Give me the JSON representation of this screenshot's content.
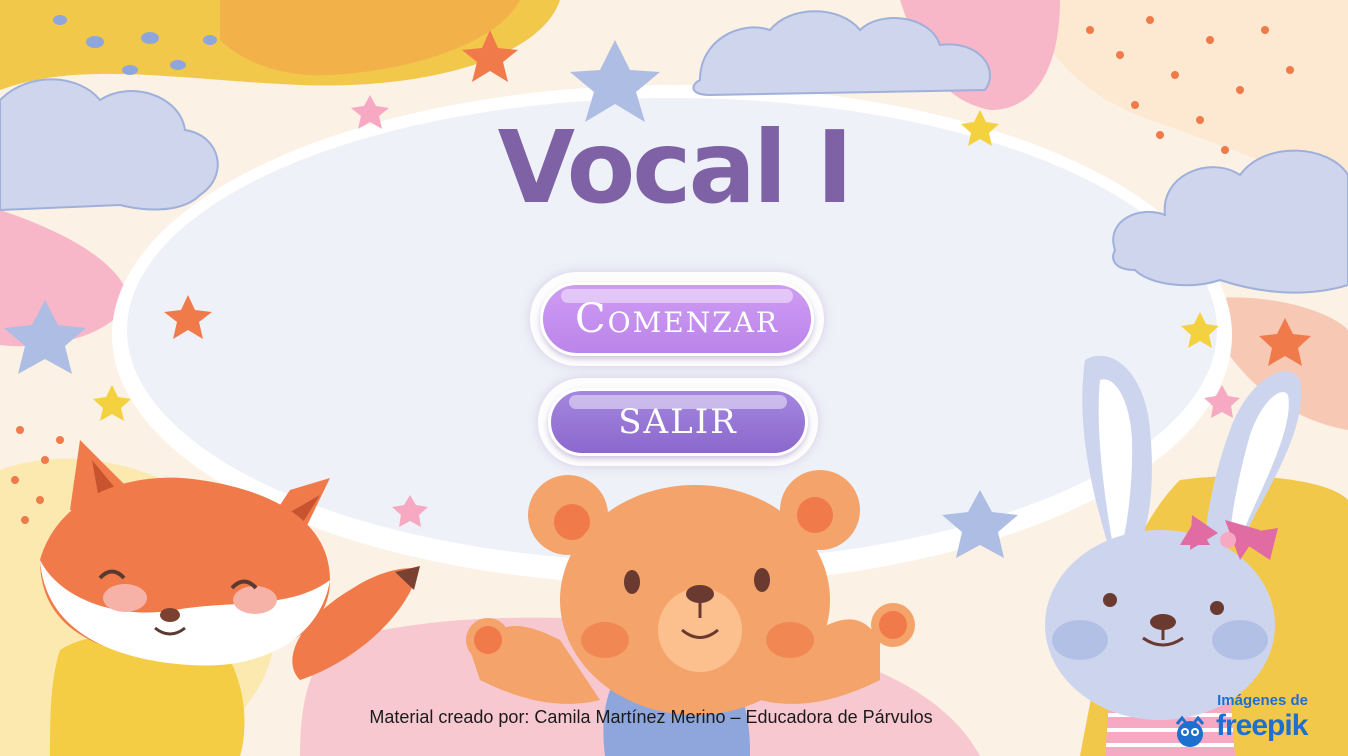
{
  "title": "Vocal I",
  "buttons": {
    "start_label": "Comenzar",
    "exit_label": "SALIR"
  },
  "credit": "Material creado por: Camila Martínez Merino – Educadora de Párvulos",
  "freepik": {
    "caption": "Imágenes de",
    "brand": "freepik"
  },
  "colors": {
    "title": "#7e62a5",
    "start_button": "#c58ff0",
    "exit_button": "#9676d6",
    "freepik": "#1f6fd1"
  }
}
